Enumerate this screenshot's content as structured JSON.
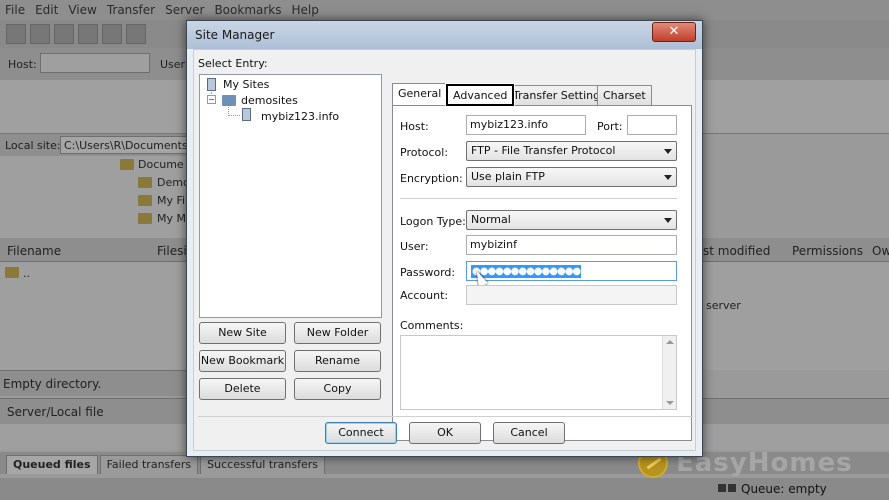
{
  "menu": [
    "File",
    "Edit",
    "View",
    "Transfer",
    "Server",
    "Bookmarks",
    "Help"
  ],
  "quickconnect": {
    "host_label": "Host:",
    "user_label": "User"
  },
  "local_site": {
    "label": "Local site:",
    "path": "C:\\Users\\R\\Documents\\W"
  },
  "local_tree": [
    "Docume",
    "Demo",
    "My Fi",
    "My M"
  ],
  "file_columns": {
    "filename": "Filename",
    "filesize": "Filesi",
    "last_modified": "st modified",
    "permissions": "Permissions",
    "owner": "Ow"
  },
  "file_rows": [
    ".."
  ],
  "remote_message": "server",
  "local_status": "Empty directory.",
  "queue_header": "Server/Local file",
  "queue_tabs": [
    "Queued files",
    "Failed transfers",
    "Successful transfers"
  ],
  "queue_status": "Queue: empty",
  "watermark": "EasyHomes",
  "dialog": {
    "title": "Site Manager",
    "close_label": "✕",
    "select_entry_label": "Select Entry:",
    "tree": {
      "root": "My Sites",
      "folder": "demosites",
      "site": "mybiz123.info"
    },
    "buttons": {
      "new_site": "New Site",
      "new_folder": "New Folder",
      "new_bookmark": "New Bookmark",
      "rename": "Rename",
      "delete": "Delete",
      "copy": "Copy"
    },
    "tabs": {
      "general": "General",
      "advanced": "Advanced",
      "transfer_settings": "Transfer Settings",
      "charset": "Charset"
    },
    "general": {
      "host_label": "Host:",
      "host_value": "mybiz123.info",
      "port_label": "Port:",
      "port_value": "",
      "protocol_label": "Protocol:",
      "protocol_value": "FTP - File Transfer Protocol",
      "encryption_label": "Encryption:",
      "encryption_value": "Use plain FTP",
      "logon_type_label": "Logon Type:",
      "logon_type_value": "Normal",
      "user_label": "User:",
      "user_value": "mybizinf",
      "password_label": "Password:",
      "password_value": "●●●●●●●●●●●●●●",
      "account_label": "Account:",
      "account_value": "",
      "comments_label": "Comments:"
    },
    "footer": {
      "connect": "Connect",
      "ok": "OK",
      "cancel": "Cancel"
    }
  }
}
